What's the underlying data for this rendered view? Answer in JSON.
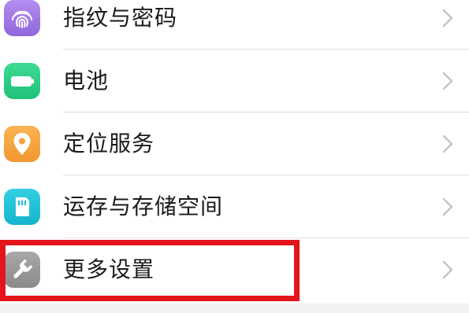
{
  "settings": {
    "items": [
      {
        "label": "指纹与密码",
        "icon": "fingerprint-icon",
        "icon_color": "#a27be8"
      },
      {
        "label": "电池",
        "icon": "battery-icon",
        "icon_color": "#2ccf86"
      },
      {
        "label": "定位服务",
        "icon": "location-pin-icon",
        "icon_color": "#f7a53c"
      },
      {
        "label": "运存与存储空间",
        "icon": "storage-card-icon",
        "icon_color": "#22c3d8"
      },
      {
        "label": "更多设置",
        "icon": "wrench-icon",
        "icon_color": "#9b9b9b"
      }
    ],
    "chevron_icon": "chevron-right-icon"
  },
  "annotation": {
    "highlight_color": "#e3141b"
  }
}
